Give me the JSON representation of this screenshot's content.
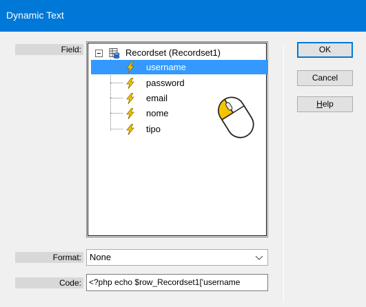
{
  "window": {
    "title": "Dynamic Text"
  },
  "field": {
    "label": "Field:",
    "root": "Recordset (Recordset1)",
    "items": [
      {
        "label": "username",
        "selected": true
      },
      {
        "label": "password",
        "selected": false
      },
      {
        "label": "email",
        "selected": false
      },
      {
        "label": "nome",
        "selected": false
      },
      {
        "label": "tipo",
        "selected": false
      }
    ]
  },
  "format": {
    "label": "Format:",
    "value": "None"
  },
  "code": {
    "label": "Code:",
    "value": "<?php echo $row_Recordset1['username"
  },
  "buttons": {
    "ok": "OK",
    "cancel": "Cancel",
    "help_mnemonic": "H",
    "help_rest": "elp"
  },
  "colors": {
    "title_bar": "#0078d7",
    "selection": "#3399ff",
    "bolt": "#f5c400",
    "mouse_button": "#f5c400"
  },
  "icons": {
    "root": "recordset-database-icon",
    "field": "lightning-bolt-icon",
    "overlay": "mouse-left-click-icon",
    "expander": "collapse-minus-icon",
    "dropdown": "chevron-down-icon"
  }
}
